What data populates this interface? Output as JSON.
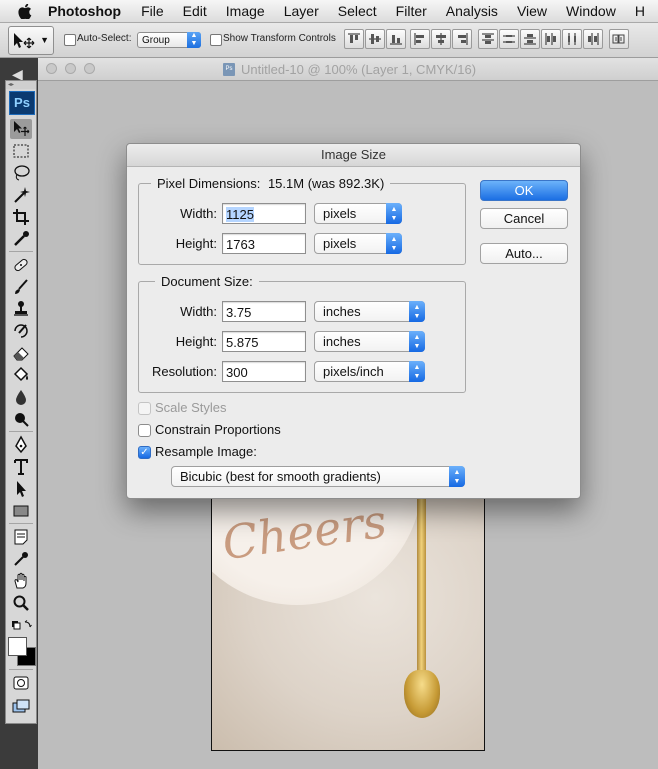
{
  "menubar": {
    "app": "Photoshop",
    "items": [
      "File",
      "Edit",
      "Image",
      "Layer",
      "Select",
      "Filter",
      "Analysis",
      "View",
      "Window",
      "H"
    ]
  },
  "options_bar": {
    "auto_select_label": "Auto-Select:",
    "auto_select_value": "Group",
    "show_transform_label": "Show Transform Controls"
  },
  "document": {
    "tab_title": "Untitled-10 @ 100% (Layer 1, CMYK/16)",
    "icon_text": "Ps",
    "canvas_text": "Cheers"
  },
  "toolbox": {
    "logo": "Ps",
    "tools": [
      "move-tool",
      "marquee-tool",
      "lasso-tool",
      "magic-wand-tool",
      "crop-tool",
      "eyedropper-tool",
      "healing-brush-tool",
      "brush-tool",
      "clone-stamp-tool",
      "history-brush-tool",
      "eraser-tool",
      "paint-bucket-tool",
      "blur-tool",
      "dodge-tool",
      "pen-tool",
      "type-tool",
      "path-selection-tool",
      "shape-tool",
      "notes-tool",
      "eyedropper-3d-tool",
      "hand-tool",
      "zoom-tool"
    ],
    "foreground_color": "#ffffff",
    "background_color": "#000000"
  },
  "dialog": {
    "title": "Image Size",
    "pixel_dimensions": {
      "label": "Pixel Dimensions:",
      "size": "15.1M (was 892.3K)",
      "width_label": "Width:",
      "width_value_selected": "1125",
      "width_unit": "pixels",
      "height_label": "Height:",
      "height_value": "1763",
      "height_unit": "pixels"
    },
    "document_size": {
      "label": "Document Size:",
      "width_label": "Width:",
      "width_value": "3.75",
      "width_unit": "inches",
      "height_label": "Height:",
      "height_value": "5.875",
      "height_unit": "inches",
      "resolution_label": "Resolution:",
      "resolution_value": "300",
      "resolution_unit": "pixels/inch"
    },
    "options": {
      "scale_styles": "Scale Styles",
      "constrain_proportions": "Constrain Proportions",
      "resample_image": "Resample Image:",
      "resample_method": "Bicubic (best for smooth gradients)"
    },
    "buttons": {
      "ok": "OK",
      "cancel": "Cancel",
      "auto": "Auto..."
    }
  },
  "colors": {
    "accent_blue": "#1b6ee3",
    "selection_highlight": "#b5d5ff"
  }
}
